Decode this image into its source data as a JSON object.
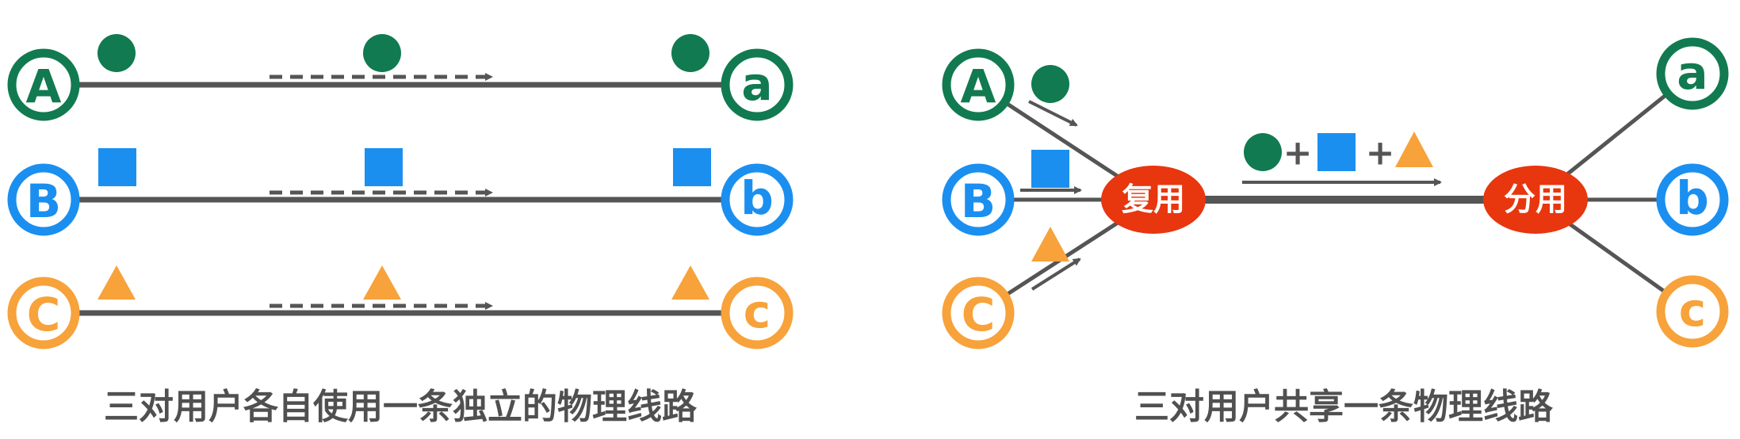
{
  "colors": {
    "green": "#117a50",
    "blue": "#1a8ff0",
    "orange": "#f7a23a",
    "line": "#555555",
    "mux": "#e8360f",
    "caption": "#505050"
  },
  "left": {
    "caption": "三对用户各自使用一条独立的物理线路",
    "senders": [
      "A",
      "B",
      "C"
    ],
    "receivers": [
      "a",
      "b",
      "c"
    ],
    "signals": [
      "green-circle-icon",
      "blue-square-icon",
      "orange-triangle-icon"
    ]
  },
  "right": {
    "caption": "三对用户共享一条物理线路",
    "senders": [
      "A",
      "B",
      "C"
    ],
    "receivers": [
      "a",
      "b",
      "c"
    ],
    "mux_label": "复用",
    "demux_label": "分用",
    "plus_1": "+",
    "plus_2": "+"
  }
}
